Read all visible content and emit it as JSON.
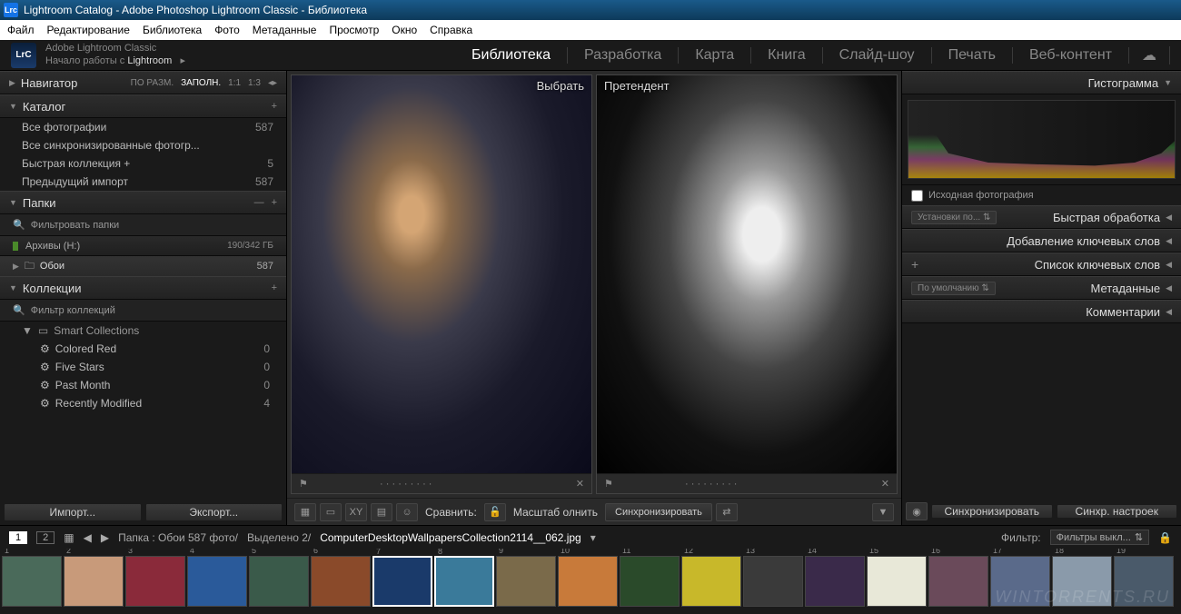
{
  "titlebar": "Lightroom Catalog - Adobe Photoshop Lightroom Classic - Библиотека",
  "menubar": [
    "Файл",
    "Редактирование",
    "Библиотека",
    "Фото",
    "Метаданные",
    "Просмотр",
    "Окно",
    "Справка"
  ],
  "identity": {
    "line1": "Adobe Lightroom Classic",
    "line2_a": "Начало работы с ",
    "line2_b": "Lightroom"
  },
  "modules": [
    "Библиотека",
    "Разработка",
    "Карта",
    "Книга",
    "Слайд-шоу",
    "Печать",
    "Веб-контент"
  ],
  "navigator": {
    "title": "Навигатор",
    "opts": [
      "ПО РАЗМ.",
      "ЗАПОЛН.",
      "1:1",
      "1:3"
    ]
  },
  "catalog": {
    "title": "Каталог",
    "rows": [
      {
        "label": "Все фотографии",
        "count": "587"
      },
      {
        "label": "Все синхронизированные фотогр...",
        "count": ""
      },
      {
        "label": "Быстрая коллекция  +",
        "count": "5"
      },
      {
        "label": "Предыдущий импорт",
        "count": "587"
      }
    ]
  },
  "folders": {
    "title": "Папки",
    "filter": "Фильтровать папки",
    "drive": "Архивы (H:)",
    "drive_stats": "190/342 ГБ",
    "folder": "Обои",
    "folder_count": "587"
  },
  "collections": {
    "title": "Коллекции",
    "filter": "Фильтр коллекций",
    "smart": "Smart Collections",
    "items": [
      {
        "label": "Colored Red",
        "count": "0"
      },
      {
        "label": "Five Stars",
        "count": "0"
      },
      {
        "label": "Past Month",
        "count": "0"
      },
      {
        "label": "Recently Modified",
        "count": "4"
      }
    ]
  },
  "import_btn": "Импорт...",
  "export_btn": "Экспорт...",
  "compare": {
    "select": "Выбрать",
    "candidate": "Претендент"
  },
  "toolbar": {
    "compare": "Сравнить:",
    "scale": "Масштаб",
    "fit": "олнить",
    "sync": "Синхронизировать"
  },
  "right": {
    "histogram": "Гистограмма",
    "source": "Исходная фотография",
    "presets": "Установки по...",
    "quick": "Быстрая обработка",
    "addkw": "Добавление ключевых слов",
    "kwlist": "Список ключевых слов",
    "default": "По умолчанию",
    "meta": "Метаданные",
    "comments": "Комментарии",
    "sync": "Синхронизировать",
    "syncset": "Синхр. настроек"
  },
  "filmstrip": {
    "path": "Папка : Обои  587 фото/",
    "selected": "Выделено 2/",
    "filename": "ComputerDesktopWallpapersCollection2114__062.jpg",
    "filter": "Фильтр:",
    "filter_val": "Фильтры выкл..."
  },
  "thumbs": [
    1,
    2,
    3,
    4,
    5,
    6,
    7,
    8,
    9,
    10,
    11,
    12,
    13,
    14,
    15,
    16,
    17,
    18,
    19
  ],
  "thumb_colors": [
    "#4a6a5a",
    "#c89a7a",
    "#8a2a3a",
    "#2a5a9a",
    "#3a5a4a",
    "#8a4a2a",
    "#1a3a6a",
    "#3a7a9a",
    "#7a6a4a",
    "#c87a3a",
    "#2a4a2a",
    "#c8b82a",
    "#3a3a3a",
    "#3a2a4a",
    "#e8e8d8",
    "#6a4a5a",
    "#5a6a8a",
    "#8a9aaa",
    "#4a5a6a"
  ]
}
